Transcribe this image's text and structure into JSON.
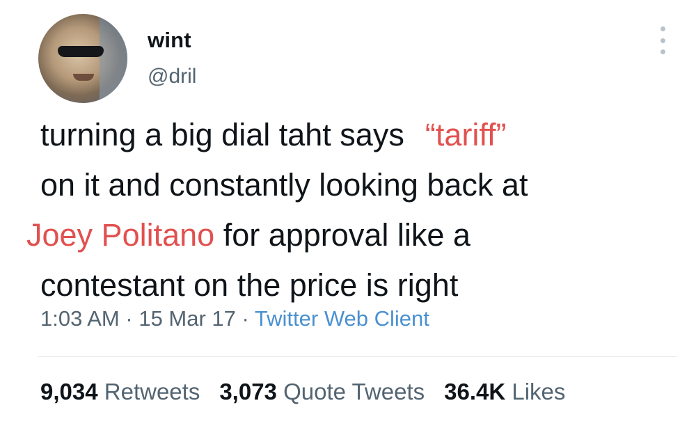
{
  "author": {
    "display_name": "wint",
    "handle": "@dril"
  },
  "tweet": {
    "line1_a": "turning a big dial taht says",
    "line1_b": "“tariff”",
    "line2": "on it and constantly looking back at",
    "line3_a": "Joey Politano",
    "line3_b": "for approval like a",
    "line4": "contestant on the price is right"
  },
  "meta": {
    "time": "1:03 AM",
    "sep1": "·",
    "date": "15 Mar 17",
    "sep2": "·",
    "source": "Twitter Web Client"
  },
  "stats": {
    "retweets_count": "9,034",
    "retweets_label": "Retweets",
    "quotes_count": "3,073",
    "quotes_label": "Quote Tweets",
    "likes_count": "36.4K",
    "likes_label": "Likes"
  },
  "colors": {
    "highlight": "#e1514f",
    "link": "#4a90d0",
    "secondary_text": "#536471"
  },
  "icons": {
    "more": "more-vertical-icon"
  }
}
